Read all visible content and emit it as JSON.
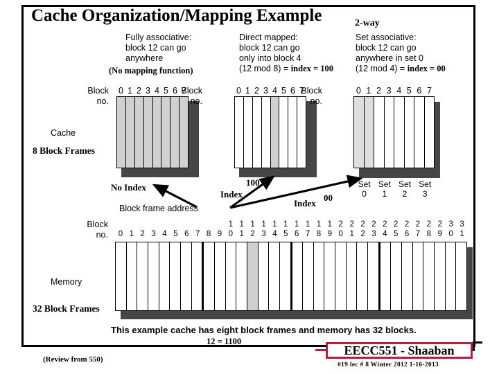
{
  "slide": {
    "title": "Cache Organization/Mapping Example",
    "review_note": "(Review from 550)"
  },
  "columns": [
    {
      "name": "fully-associative",
      "line1": "Fully associative:",
      "line2": "block 12 can go",
      "line3": "anywhere",
      "formula": "(No mapping function)"
    },
    {
      "name": "direct-mapped",
      "line1": "Direct mapped:",
      "line2": "block 12 can go",
      "line3": "only into block 4",
      "formula_plain": "(12 mod 8)  = ",
      "formula_bold": "index = 100"
    },
    {
      "name": "set-associative",
      "header": "2-way",
      "line1": "Set associative:",
      "line2": "block 12 can go",
      "line3": "anywhere in set 0",
      "formula_plain": "(12 mod 4)  = ",
      "formula_bold": "index = 00"
    }
  ],
  "cache": {
    "block_label_line1": "Block",
    "block_label_line2": "no.",
    "block_numbers": [
      "0",
      "1",
      "2",
      "3",
      "4",
      "5",
      "6",
      "7"
    ],
    "left_label_sans": "Cache",
    "left_label_serif": "8 Block Frames",
    "fully_associative_shaded": [
      0,
      1,
      2,
      3,
      4,
      5,
      6,
      7
    ],
    "direct_mapped_shaded": [
      4
    ],
    "set_associative_shaded": [
      0,
      1
    ],
    "set_labels": [
      "Set",
      "Set",
      "Set",
      "Set"
    ],
    "set_numbers": [
      "0",
      "1",
      "2",
      "3"
    ]
  },
  "annotations": {
    "no_index": "No Index",
    "index_label_1": "Index",
    "index_value_1": "100",
    "index_label_2": "Index",
    "index_value_2": "00",
    "block_frame_address": "Block frame address"
  },
  "memory": {
    "block_label_line1": "Block",
    "block_label_line2": "no.",
    "left_label_sans": "Memory",
    "left_label_serif": "32 Block Frames",
    "tens_digits": [
      "",
      "",
      "",
      "",
      "",
      "",
      "",
      "",
      "",
      "",
      "1",
      "1",
      "1",
      "1",
      "1",
      "1",
      "1",
      "1",
      "1",
      "1",
      "2",
      "2",
      "2",
      "2",
      "2",
      "2",
      "2",
      "2",
      "2",
      "2",
      "3",
      "3"
    ],
    "ones_digits": [
      "0",
      "1",
      "2",
      "3",
      "4",
      "5",
      "6",
      "7",
      "8",
      "9",
      "0",
      "1",
      "2",
      "3",
      "4",
      "5",
      "6",
      "7",
      "8",
      "9",
      "0",
      "1",
      "2",
      "3",
      "4",
      "5",
      "6",
      "7",
      "8",
      "9",
      "0",
      "1"
    ],
    "shaded": [
      12
    ],
    "group_boundaries": [
      8,
      16,
      24
    ]
  },
  "caption": {
    "text": "This example cache has eight block frames and memory has 32 blocks.",
    "binary_note": "12 =  1100"
  },
  "footer": {
    "banner": "EECC551 - Shaaban",
    "sub": "#19   lec # 8   Winter 2012  1-16-2013"
  },
  "colors": {
    "shade_gray": "#d0d0d0",
    "shadow_dark": "#464646",
    "banner_red": "#b2203c",
    "ink": "#000000"
  }
}
